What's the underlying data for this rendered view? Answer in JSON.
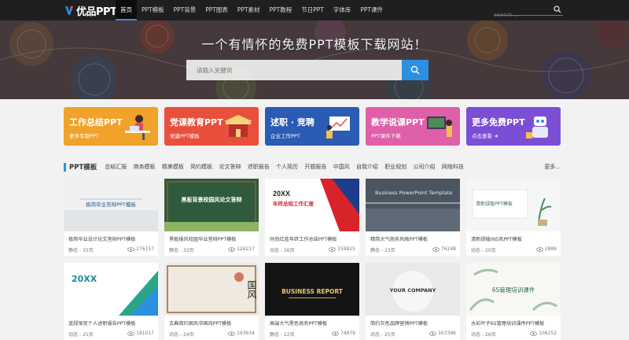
{
  "nav": {
    "logo_text": "优品PPT",
    "items": [
      "首页",
      "PPT模板",
      "PPT背景",
      "PPT图表",
      "PPT素材",
      "PPT教程",
      "节日PPT",
      "字体库",
      "PPT课件"
    ],
    "search_placeholder": "search ...",
    "accent": "#3c8dde"
  },
  "hero": {
    "title": "一个有情怀的免费PPT模板下载网站！",
    "search_placeholder": "请输入关键词",
    "button_color": "#2c8fe0"
  },
  "cards": [
    {
      "title": "工作总结PPT",
      "sub": "更多专题PPT",
      "color": "#f0a22a"
    },
    {
      "title": "党课教育PPT",
      "sub": "党建PPT模板",
      "color": "#e8503c"
    },
    {
      "title": "述职 · 竞聘",
      "sub": "企业工作PPT",
      "color": "#2a5bb5"
    },
    {
      "title": "教学说课PPT",
      "sub": "PPT课件下载",
      "color": "#df5fa8"
    },
    {
      "title": "更多免费PPT",
      "sub": "点击查看 ➜",
      "color": "#7a4fd6"
    }
  ],
  "section": {
    "title": "PPT模板",
    "tags": [
      "总结汇报",
      "商务模板",
      "精美模板",
      "简约模板",
      "论文答辩",
      "述职报告",
      "个人简历",
      "开题报告",
      "中国风",
      "自我介绍",
      "职业规划",
      "公司介绍",
      "网络科技"
    ],
    "more": "更多..."
  },
  "templates": [
    {
      "title": "极简毕业设计论文答辩PPT模板",
      "meta": "静态 - 33页",
      "views": "276157",
      "thumb_text": "极简毕业答辩PPT模板"
    },
    {
      "title": "黑板报风校园毕业答辩PPT模板",
      "meta": "静态 - 33页",
      "views": "126217",
      "thumb_text": "黑板背景校园风论文答辩"
    },
    {
      "title": "时尚红蓝年终工作总结PPT模板",
      "meta": "动态 - 26页",
      "views": "159925",
      "thumb_text": "年终总结工作汇报"
    },
    {
      "title": "精简大气商务风格PPT模板",
      "meta": "静态 - 23页",
      "views": "76248",
      "thumb_text": "Business PowerPoint Template"
    },
    {
      "title": "清新绿植INS风PPT模板",
      "meta": "动态 - 20页",
      "views": "2886",
      "thumb_text": "清新绿植PPT模板"
    },
    {
      "title": "蓝绿渐变个人述职报告PPT模板",
      "meta": "动态 - 25页",
      "views": "191017",
      "thumb_text": "20XX"
    },
    {
      "title": "古典简约国风中国风PPT模板",
      "meta": "动态 - 24页",
      "views": "193634",
      "thumb_text": "国风"
    },
    {
      "title": "高端大气黑色商务PPT模板",
      "meta": "静态 - 22页",
      "views": "74979",
      "thumb_text": "BUSINESS REPORT"
    },
    {
      "title": "简约灰色品牌营销PPT模板",
      "meta": "动态 - 25页",
      "views": "163396",
      "thumb_text": "YOUR COMPANY"
    },
    {
      "title": "水彩叶子6S管理培训课件PPT模板",
      "meta": "动态 - 26页",
      "views": "106252",
      "thumb_text": "6S管理培训课件"
    }
  ]
}
